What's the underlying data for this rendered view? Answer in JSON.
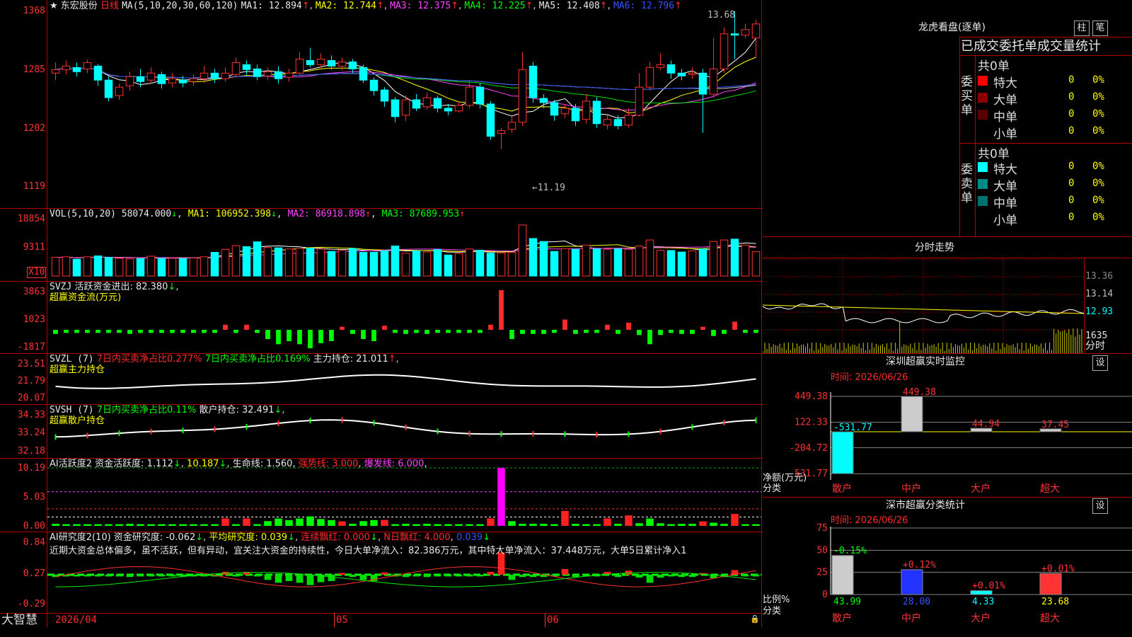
{
  "header": {
    "stock_name": "东宏股份",
    "period": "日线",
    "ma_label": "MA(5,10,20,30,60,120)",
    "ma1": "MA1: 12.894",
    "ma2": "MA2: 12.744",
    "ma3": "MA3: 12.375",
    "ma4": "MA4: 12.225",
    "ma5": "MA5: 12.408",
    "ma6": "MA6: 12.796",
    "up_arrow": "↑",
    "high_marker": "13.68",
    "low_marker": "11.19"
  },
  "price_axis": [
    "1368",
    "1285",
    "1202",
    "1119"
  ],
  "vol_panel": {
    "label": "VOL(5,10,20)",
    "value": "58074.000",
    "ma1": "MA1: 106952.398",
    "ma2": "MA2: 86918.898",
    "ma3": "MA3: 87689.953",
    "axis": [
      "18854",
      "9311"
    ],
    "unit": "X10"
  },
  "svzj_panel": {
    "label": "SVZJ",
    "text": "活跃资金进出: 82.380",
    "subtitle": "超赢资金流(万元)",
    "axis": [
      "3863",
      "1023",
      "-1817"
    ]
  },
  "svzl_panel": {
    "label": "SVZL (7)",
    "text1": "7日内买卖净占比0.277%",
    "text2": "7日内买卖净占比0.169%",
    "text3": "主力持仓: 21.011",
    "subtitle": "超赢主力持仓",
    "axis": [
      "23.51",
      "21.79",
      "20.07"
    ]
  },
  "svsh_panel": {
    "label": "SVSH (7)",
    "text1": "7日内买卖净占比0.11%",
    "text2": "散户持仓: 32.491",
    "subtitle": "超赢散户持仓",
    "axis": [
      "34.33",
      "33.24",
      "32.18"
    ]
  },
  "ai1_panel": {
    "label": "AI活跃度2",
    "text1": "资金活跃度: 1.112",
    "text2": "10.187",
    "text3": "生命线: 1.560",
    "text4": "强势线: 3.000",
    "text5": "爆发线: 6.000",
    "axis": [
      "10.19",
      "5.03",
      "0.00"
    ]
  },
  "ai2_panel": {
    "label": "AI研究度2(10)",
    "text1": "资金研究度: -0.062",
    "text2": "平均研究度: 0.039",
    "text3": "连续飘红: 0.000",
    "text4": "N日飘红: 4.000",
    "text5": "0.039",
    "comment": "近期大资金总体偏多，虽不活跃，但有异动，宜关注大资金的持续性，今日大单净流入：82.386万元，其中特大单净流入：37.448万元，大单5日累计净入1",
    "axis": [
      "0.84",
      "0.27",
      "-0.29"
    ]
  },
  "bottom_bar": {
    "brand": "大智慧",
    "dates": [
      "2026/04",
      "05",
      "06"
    ]
  },
  "right_panel": {
    "dragon_title": "龙虎看盘(逐单)",
    "btn_zhu": "柱",
    "btn_bi": "笔",
    "stats_title": "已成交委托单成交量统计",
    "buy": {
      "label": "委买单",
      "total": "共0单",
      "rows": [
        {
          "name": "特大",
          "count": "0",
          "pct": "0%",
          "color": "#ff0000"
        },
        {
          "name": "大单",
          "count": "0",
          "pct": "0%",
          "color": "#8b0000"
        },
        {
          "name": "中单",
          "count": "0",
          "pct": "0%",
          "color": "#5a0000"
        },
        {
          "name": "小单",
          "count": "0",
          "pct": "0%",
          "color": ""
        }
      ]
    },
    "sell": {
      "label": "委卖单",
      "total": "共0单",
      "rows": [
        {
          "name": "特大",
          "count": "0",
          "pct": "0%",
          "color": "#00ffff"
        },
        {
          "name": "大单",
          "count": "0",
          "pct": "0%",
          "color": "#008b8b"
        },
        {
          "name": "中单",
          "count": "0",
          "pct": "0%",
          "color": "#007070"
        },
        {
          "name": "小单",
          "count": "0",
          "pct": "0%",
          "color": ""
        }
      ]
    },
    "intraday": {
      "title": "分时走势",
      "axis": [
        "13.36",
        "13.14",
        "12.93"
      ],
      "vol_axis": "1635",
      "footer": "分时"
    },
    "sz_monitor": {
      "title": "深圳超赢实时监控",
      "btn": "设",
      "time": "时间: 2026/06/26",
      "axis": [
        "449.38",
        "122.33",
        "-204.72",
        "-531.77"
      ],
      "ylabel": "净额(万元)",
      "xlabel": "分类",
      "categories": [
        "散户",
        "中户",
        "大户",
        "超大"
      ],
      "value_labels": [
        "-531.77",
        "449.38",
        "44.94",
        "37.45"
      ]
    },
    "sz_class": {
      "title": "深市超赢分类统计",
      "btn": "设",
      "time": "时间: 2026/06/26",
      "axis": [
        "75",
        "50",
        "25",
        "0"
      ],
      "ylabel": "比例%",
      "xlabel": "分类",
      "categories": [
        "散户",
        "中户",
        "大户",
        "超大"
      ],
      "top_labels": [
        "-0.15%",
        "+0.12%",
        "+0.01%",
        "+0.01%"
      ],
      "bottom_labels": [
        "43.99",
        "28.00",
        "4.33",
        "23.68"
      ]
    }
  },
  "chart_data": [
    {
      "type": "candlestick",
      "title": "东宏股份 日线",
      "ylim": [
        11.19,
        13.68
      ],
      "x": [
        "2026/04",
        "05",
        "06"
      ],
      "candles": [
        [
          12.8,
          12.85,
          12.95,
          12.7
        ],
        [
          12.85,
          12.9,
          12.98,
          12.78
        ],
        [
          12.88,
          12.82,
          12.95,
          12.75
        ],
        [
          12.86,
          12.95,
          12.99,
          12.8
        ],
        [
          12.9,
          12.7,
          12.93,
          12.62
        ],
        [
          12.7,
          12.45,
          12.75,
          12.4
        ],
        [
          12.48,
          12.6,
          12.65,
          12.42
        ],
        [
          12.62,
          12.75,
          12.82,
          12.55
        ],
        [
          12.75,
          12.68,
          12.86,
          12.6
        ],
        [
          12.7,
          12.8,
          12.88,
          12.65
        ],
        [
          12.78,
          12.65,
          12.82,
          12.58
        ],
        [
          12.66,
          12.72,
          12.8,
          12.6
        ],
        [
          12.7,
          12.66,
          12.76,
          12.6
        ],
        [
          12.68,
          12.72,
          12.78,
          12.62
        ],
        [
          12.72,
          12.8,
          12.9,
          12.66
        ],
        [
          12.8,
          12.72,
          12.86,
          12.66
        ],
        [
          12.72,
          12.8,
          12.88,
          12.68
        ],
        [
          12.78,
          12.95,
          13.02,
          12.74
        ],
        [
          12.92,
          12.85,
          12.98,
          12.78
        ],
        [
          12.86,
          12.75,
          12.92,
          12.7
        ],
        [
          12.76,
          12.82,
          12.88,
          12.7
        ],
        [
          12.82,
          12.72,
          12.9,
          12.65
        ],
        [
          12.74,
          12.8,
          12.86,
          12.68
        ],
        [
          12.8,
          13.0,
          13.1,
          12.78
        ],
        [
          12.98,
          12.92,
          13.16,
          12.88
        ],
        [
          12.92,
          13.0,
          13.08,
          12.88
        ],
        [
          12.98,
          12.9,
          13.05,
          12.85
        ],
        [
          12.9,
          12.96,
          13.02,
          12.84
        ],
        [
          12.96,
          12.86,
          13.0,
          12.8
        ],
        [
          12.88,
          12.7,
          12.92,
          12.66
        ],
        [
          12.7,
          12.55,
          12.74,
          12.48
        ],
        [
          12.56,
          12.4,
          12.6,
          12.32
        ],
        [
          12.42,
          12.18,
          12.46,
          12.1
        ],
        [
          12.2,
          12.42,
          12.48,
          12.12
        ],
        [
          12.42,
          12.3,
          12.5,
          12.26
        ],
        [
          12.32,
          12.45,
          12.52,
          12.28
        ],
        [
          12.44,
          12.3,
          12.48,
          12.24
        ],
        [
          12.3,
          12.26,
          12.36,
          12.2
        ],
        [
          12.26,
          12.34,
          12.4,
          12.24
        ],
        [
          12.34,
          12.6,
          12.7,
          12.3
        ],
        [
          12.6,
          12.36,
          12.66,
          12.3
        ],
        [
          12.36,
          11.9,
          12.4,
          11.85
        ],
        [
          11.94,
          11.98,
          12.02,
          11.72
        ],
        [
          12.0,
          12.1,
          12.2,
          11.95
        ],
        [
          12.1,
          12.85,
          13.1,
          12.05
        ],
        [
          12.9,
          12.45,
          12.96,
          12.38
        ],
        [
          12.44,
          12.38,
          12.5,
          12.3
        ],
        [
          12.38,
          12.2,
          12.42,
          12.12
        ],
        [
          12.22,
          12.3,
          12.36,
          12.16
        ],
        [
          12.3,
          12.12,
          12.36,
          12.05
        ],
        [
          12.14,
          12.4,
          12.5,
          12.08
        ],
        [
          12.4,
          12.08,
          12.46,
          12.02
        ],
        [
          12.06,
          12.14,
          12.2,
          12.0
        ],
        [
          12.14,
          12.05,
          12.2,
          12.0
        ],
        [
          12.06,
          12.2,
          12.3,
          12.02
        ],
        [
          12.2,
          12.6,
          12.8,
          12.18
        ],
        [
          12.6,
          12.88,
          12.96,
          12.55
        ],
        [
          12.88,
          12.92,
          13.08,
          12.84
        ],
        [
          12.92,
          12.8,
          12.98,
          12.72
        ],
        [
          12.8,
          12.76,
          12.86,
          12.7
        ],
        [
          12.78,
          12.8,
          12.88,
          12.72
        ],
        [
          12.8,
          12.5,
          12.86,
          11.95
        ],
        [
          12.5,
          12.86,
          13.3,
          12.45
        ],
        [
          12.86,
          13.36,
          13.45,
          12.8
        ],
        [
          13.36,
          13.34,
          13.68,
          13.0
        ],
        [
          13.34,
          13.42,
          13.5,
          13.3
        ],
        [
          13.3,
          13.5,
          13.56,
          13.02
        ]
      ]
    },
    {
      "type": "bar",
      "title": "VOL(5,10,20)",
      "ylim": [
        0,
        18854
      ],
      "values": [
        6200,
        6400,
        5600,
        6400,
        6700,
        6200,
        5900,
        5700,
        5800,
        6600,
        5900,
        5900,
        5800,
        6000,
        6400,
        7900,
        8900,
        10100,
        9800,
        11400,
        9500,
        9400,
        9000,
        9200,
        9300,
        9000,
        8200,
        8600,
        9200,
        7900,
        7900,
        8400,
        10000,
        7600,
        8400,
        8000,
        8800,
        7000,
        7500,
        9000,
        8600,
        7600,
        7700,
        7900,
        17000,
        12500,
        11500,
        8200,
        9100,
        8900,
        10300,
        9000,
        8900,
        9000,
        8900,
        10000,
        12000,
        8600,
        8500,
        8000,
        8400,
        9000,
        11500,
        12000,
        12300,
        10300,
        8100
      ]
    },
    {
      "type": "bar",
      "title": "超赢资金流(万元)",
      "ylim": [
        -1817,
        3863
      ],
      "values": [
        -400,
        -300,
        -300,
        -300,
        -300,
        -300,
        -300,
        -400,
        -300,
        -300,
        -300,
        -300,
        -300,
        -300,
        -300,
        -300,
        500,
        -300,
        500,
        -300,
        -900,
        -1400,
        -1100,
        -1400,
        -1800,
        -1300,
        -1100,
        300,
        -400,
        -900,
        -1100,
        400,
        -300,
        -400,
        -300,
        -400,
        -300,
        -300,
        -300,
        -300,
        -300,
        500,
        3863,
        -900,
        -400,
        -400,
        -400,
        -300,
        1000,
        -400,
        -300,
        -300,
        500,
        -400,
        700,
        -500,
        -1400,
        -500,
        -300,
        -400,
        -400,
        300,
        -600,
        -400,
        800,
        -300,
        -300
      ]
    }
  ]
}
